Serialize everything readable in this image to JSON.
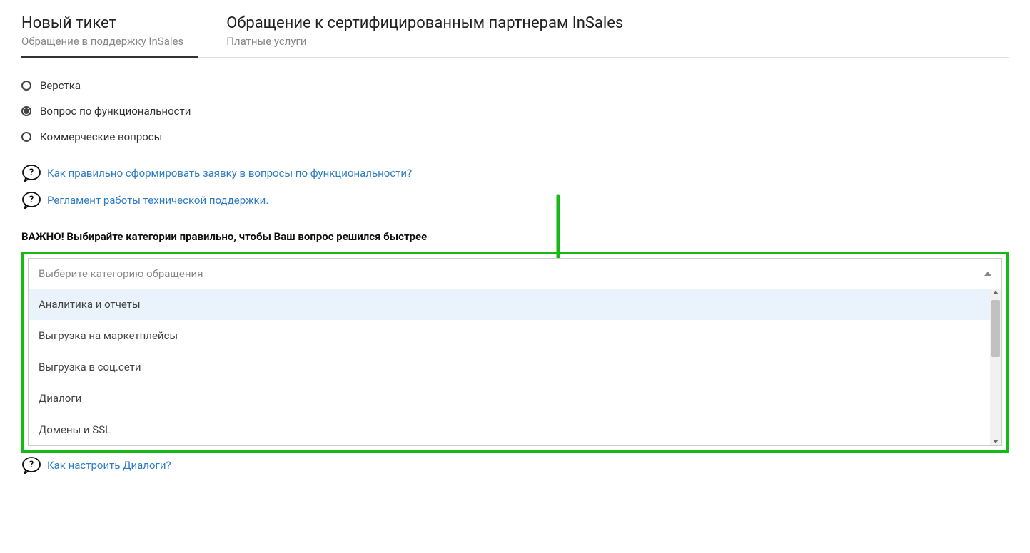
{
  "tabs": [
    {
      "title": "Новый тикет",
      "sub": "Обращение в поддержку InSales",
      "active": true
    },
    {
      "title": "Обращение к сертифицированным партнерам InSales",
      "sub": "Платные услуги",
      "active": false
    }
  ],
  "radios": [
    {
      "label": "Верстка",
      "checked": false
    },
    {
      "label": "Вопрос по функциональности",
      "checked": true
    },
    {
      "label": "Коммерческие вопросы",
      "checked": false
    }
  ],
  "help_links": [
    "Как правильно сформировать заявку в вопросы по функциональности?",
    "Регламент работы технической поддержки."
  ],
  "notice": "ВАЖНО! Выбирайте категории правильно, чтобы Ваш вопрос решился быстрее",
  "select": {
    "placeholder": "Выберите категорию обращения",
    "options": [
      "Аналитика и отчеты",
      "Выгрузка на маркетплейсы",
      "Выгрузка в соц.сети",
      "Диалоги",
      "Домены и SSL"
    ]
  },
  "bottom_help": "Как настроить Диалоги?",
  "colors": {
    "highlight_green": "#16b916",
    "link": "#2e7dc7"
  }
}
